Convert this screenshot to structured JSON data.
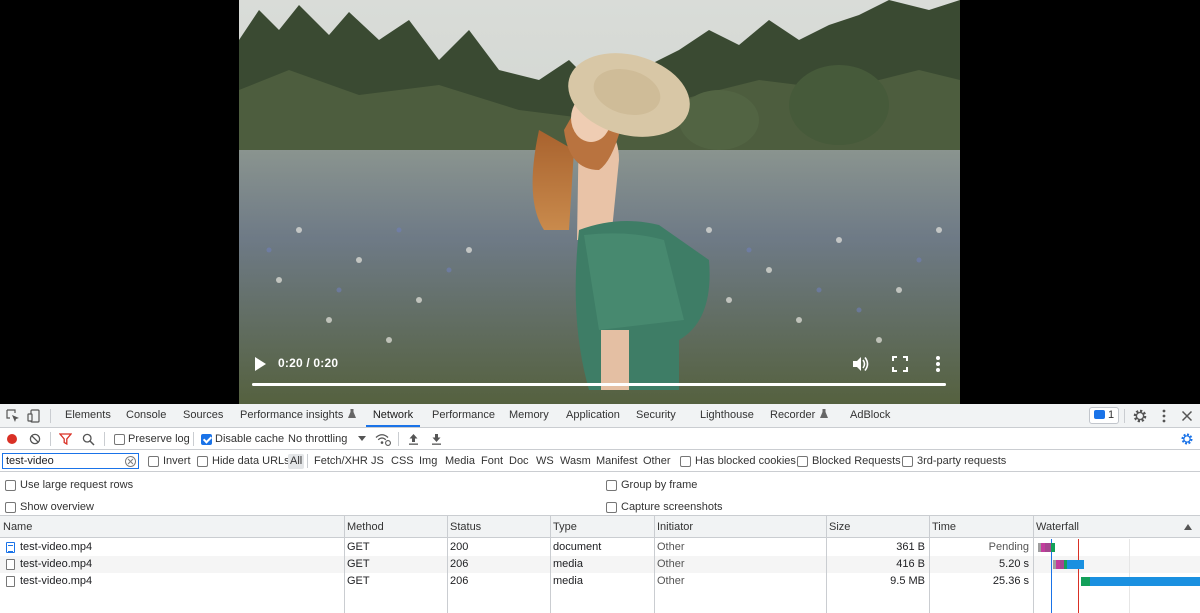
{
  "video": {
    "time_display": "0:20 / 0:20",
    "progress_fraction": 1.0,
    "controls": [
      "play-icon",
      "volume-icon",
      "fullscreen-icon",
      "more-vert-icon"
    ]
  },
  "devtools": {
    "tabs": [
      {
        "label": "Elements"
      },
      {
        "label": "Console"
      },
      {
        "label": "Sources"
      },
      {
        "label": "Performance insights"
      },
      {
        "label": "Network"
      },
      {
        "label": "Performance"
      },
      {
        "label": "Memory"
      },
      {
        "label": "Application"
      },
      {
        "label": "Security"
      },
      {
        "label": "Lighthouse"
      },
      {
        "label": "Recorder"
      },
      {
        "label": "AdBlock"
      }
    ],
    "active_tab": "Network",
    "issues_count": "1",
    "toolbar": {
      "preserve_log": "Preserve log",
      "disable_cache": "Disable cache",
      "throttling": "No throttling"
    },
    "filter": {
      "value": "test-video",
      "invert": "Invert",
      "hide_data_urls": "Hide data URLs",
      "types": [
        "All",
        "Fetch/XHR",
        "JS",
        "CSS",
        "Img",
        "Media",
        "Font",
        "Doc",
        "WS",
        "Wasm",
        "Manifest",
        "Other"
      ],
      "has_blocked_cookies": "Has blocked cookies",
      "blocked_requests": "Blocked Requests",
      "third_party": "3rd-party requests"
    },
    "settings": {
      "large_rows": "Use large request rows",
      "show_overview": "Show overview",
      "group_by_frame": "Group by frame",
      "capture_screenshots": "Capture screenshots"
    },
    "columns": [
      "Name",
      "Method",
      "Status",
      "Type",
      "Initiator",
      "Size",
      "Time",
      "Waterfall"
    ],
    "rows": [
      {
        "name": "test-video.mp4",
        "method": "GET",
        "status": "200",
        "type": "document",
        "initiator": "Other",
        "size": "361 B",
        "time": "Pending"
      },
      {
        "name": "test-video.mp4",
        "method": "GET",
        "status": "206",
        "type": "media",
        "initiator": "Other",
        "size": "416 B",
        "time": "5.20 s"
      },
      {
        "name": "test-video.mp4",
        "method": "GET",
        "status": "206",
        "type": "media",
        "initiator": "Other",
        "size": "9.5 MB",
        "time": "25.36 s"
      }
    ],
    "colors": {
      "accent": "#1a73e8",
      "record": "#d93025",
      "waterfall_blue": "#1a90e0",
      "waterfall_green": "#13a05a",
      "waterfall_pink": "#c23d9c"
    }
  }
}
